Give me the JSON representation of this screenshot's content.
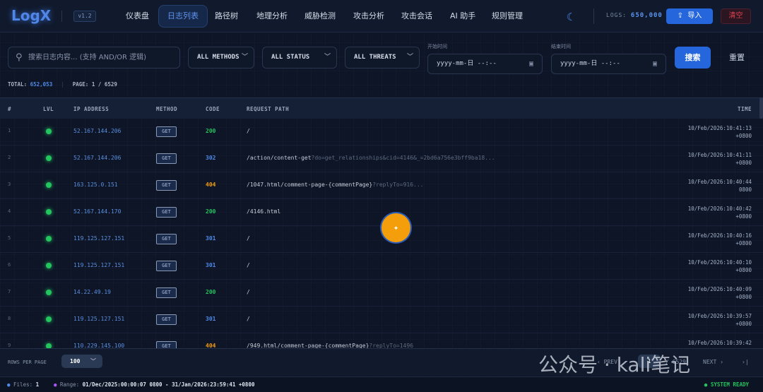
{
  "header": {
    "logo": "LogX",
    "version": "v1.2",
    "nav": [
      "仪表盘",
      "日志列表",
      "路径树",
      "地理分析",
      "威胁检测",
      "攻击分析",
      "攻击会话",
      "AI 助手",
      "规则管理"
    ],
    "active_nav": "日志列表",
    "logs_label": "LOGS:",
    "logs_count": "650,000",
    "import_label": "导入",
    "clear_label": "清空"
  },
  "filters": {
    "search_placeholder": "搜索日志内容... (支持 AND/OR 逻辑)",
    "method": "ALL METHODS",
    "status": "ALL STATUS",
    "threats": "ALL THREATS",
    "start_label": "开始时间",
    "end_label": "结束时间",
    "start_placeholder": "yyyy-mm-日 --:--",
    "end_placeholder": "yyyy-mm-日 --:--",
    "search_button": "搜索",
    "reset_button": "重置"
  },
  "stats": {
    "total_label": "TOTAL:",
    "total": "652,053",
    "page_label": "PAGE: 1 / 6529"
  },
  "table": {
    "columns": [
      "#",
      "LVL",
      "IP ADDRESS",
      "METHOD",
      "CODE",
      "REQUEST PATH",
      "TIME"
    ],
    "rows": [
      {
        "num": "1",
        "ip": "52.167.144.206",
        "method": "GET",
        "code": "200",
        "path": "/",
        "query": "",
        "time": "10/Feb/2026:10:41:13",
        "tz": "+0800"
      },
      {
        "num": "2",
        "ip": "52.167.144.206",
        "method": "GET",
        "code": "302",
        "path": "/action/content-get",
        "query": "?do=get_relationships&cid=4146&_=2bd6a756e3bff9ba18...",
        "time": "10/Feb/2026:10:41:11",
        "tz": "+0800"
      },
      {
        "num": "3",
        "ip": "163.125.0.151",
        "method": "GET",
        "code": "404",
        "path": "/1047.html/comment-page-{commentPage}",
        "query": "?replyTo=916...",
        "time": "10/Feb/2026:10:40:44",
        "tz": "0800"
      },
      {
        "num": "4",
        "ip": "52.167.144.170",
        "method": "GET",
        "code": "200",
        "path": "/4146.html",
        "query": "",
        "time": "10/Feb/2026:10:40:42",
        "tz": "+0800"
      },
      {
        "num": "5",
        "ip": "119.125.127.151",
        "method": "GET",
        "code": "301",
        "path": "/",
        "query": "",
        "time": "10/Feb/2026:10:40:16",
        "tz": "+0800"
      },
      {
        "num": "6",
        "ip": "119.125.127.151",
        "method": "GET",
        "code": "301",
        "path": "/",
        "query": "",
        "time": "10/Feb/2026:10:40:10",
        "tz": "+0800"
      },
      {
        "num": "7",
        "ip": "14.22.49.19",
        "method": "GET",
        "code": "200",
        "path": "/",
        "query": "",
        "time": "10/Feb/2026:10:40:09",
        "tz": "+0800"
      },
      {
        "num": "8",
        "ip": "119.125.127.151",
        "method": "GET",
        "code": "301",
        "path": "/",
        "query": "",
        "time": "10/Feb/2026:10:39:57",
        "tz": "+0800"
      },
      {
        "num": "9",
        "ip": "110.229.145.100",
        "method": "GET",
        "code": "404",
        "path": "/949.html/comment-page-{commentPage}",
        "query": "?replyTo=1496",
        "time": "10/Feb/2026:10:39:42",
        "tz": ""
      }
    ]
  },
  "code_colors": {
    "2": "#22c55e",
    "3": "#4f8ae8",
    "4": "#f59e0b"
  },
  "pagination": {
    "rows_label": "ROWS PER PAGE",
    "rows_value": "100",
    "prev": "‹ PREV",
    "current": "1",
    "total": "/ 6529",
    "next": "NEXT ›",
    "last": "›|"
  },
  "watermark": "公众号 · kali笔记",
  "status": {
    "files_label": "Files:",
    "files": "1",
    "range_label": "Range:",
    "range": "01/Dec/2025:00:00:07 0800 - 31/Jan/2026:23:59:41 +0800",
    "ready": "SYSTEM READY"
  }
}
